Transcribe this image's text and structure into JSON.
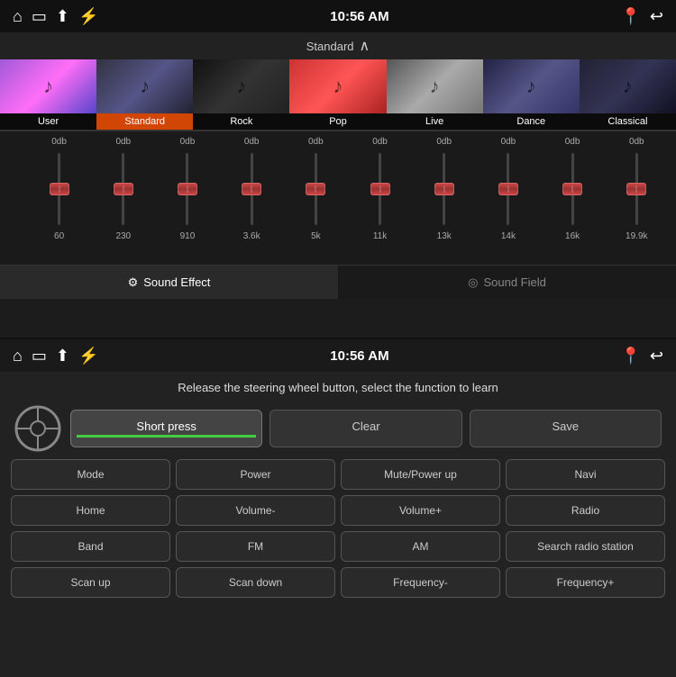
{
  "top": {
    "statusBar": {
      "time": "10:56 AM"
    },
    "preset": {
      "label": "Standard",
      "chevron": "⌃"
    },
    "presets": [
      {
        "id": "user",
        "label": "User",
        "bgClass": "thumb-user",
        "active": false
      },
      {
        "id": "standard",
        "label": "Standard",
        "bgClass": "thumb-standard",
        "active": true
      },
      {
        "id": "rock",
        "label": "Rock",
        "bgClass": "thumb-rock",
        "active": false
      },
      {
        "id": "pop",
        "label": "Pop",
        "bgClass": "thumb-pop",
        "active": false
      },
      {
        "id": "live",
        "label": "Live",
        "bgClass": "thumb-live",
        "active": false
      },
      {
        "id": "dance",
        "label": "Dance",
        "bgClass": "thumb-dance",
        "active": false
      },
      {
        "id": "classical",
        "label": "Classical",
        "bgClass": "thumb-classical",
        "active": false
      }
    ],
    "eq": {
      "scaleTop": "4",
      "scaleMid": "0",
      "scaleBot": "-4",
      "scaleUnit": "Hz",
      "bands": [
        {
          "freq": "60",
          "db": "0db",
          "pos": 50
        },
        {
          "freq": "230",
          "db": "0db",
          "pos": 50
        },
        {
          "freq": "910",
          "db": "0db",
          "pos": 50
        },
        {
          "freq": "3.6k",
          "db": "0db",
          "pos": 50
        },
        {
          "freq": "5k",
          "db": "0db",
          "pos": 50
        },
        {
          "freq": "11k",
          "db": "0db",
          "pos": 50
        },
        {
          "freq": "13k",
          "db": "0db",
          "pos": 50
        },
        {
          "freq": "14k",
          "db": "0db",
          "pos": 50
        },
        {
          "freq": "16k",
          "db": "0db",
          "pos": 50
        },
        {
          "freq": "19.9k",
          "db": "0db",
          "pos": 50
        }
      ]
    },
    "tabs": [
      {
        "id": "sound-effect",
        "label": "Sound Effect",
        "icon": "sliders",
        "active": true
      },
      {
        "id": "sound-field",
        "label": "Sound Field",
        "icon": "circle",
        "active": false
      }
    ]
  },
  "bottom": {
    "statusBar": {
      "time": "10:56 AM"
    },
    "instruction": "Release the steering wheel button, select the function to learn",
    "controls": {
      "shortPress": "Short press",
      "clear": "Clear",
      "save": "Save"
    },
    "functions": [
      "Mode",
      "Power",
      "Mute/Power up",
      "Navi",
      "Home",
      "Volume-",
      "Volume+",
      "Radio",
      "Band",
      "FM",
      "AM",
      "Search radio station",
      "Scan up",
      "Scan down",
      "Frequency-",
      "Frequency+"
    ]
  }
}
